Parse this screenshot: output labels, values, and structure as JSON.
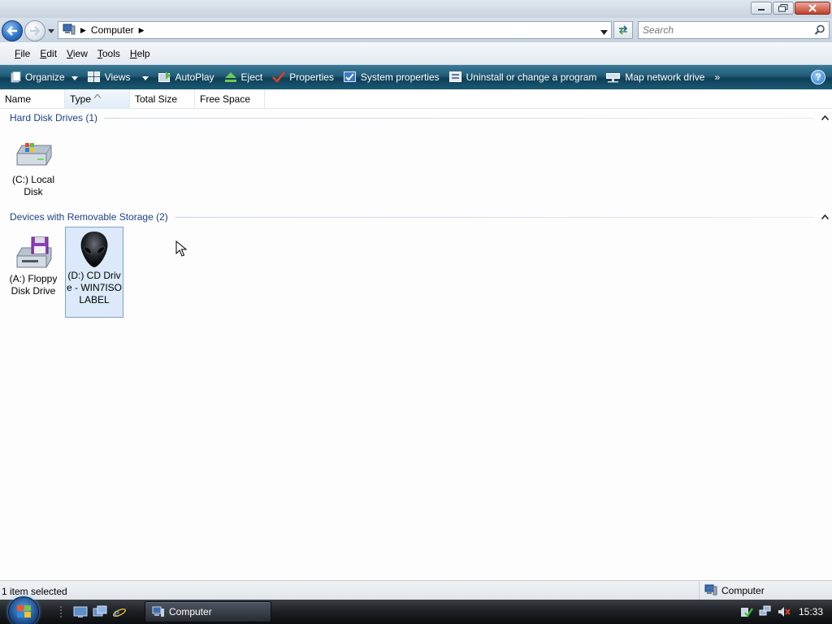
{
  "window": {
    "title": ""
  },
  "address": {
    "crumbs": [
      "Computer"
    ],
    "icon": "computer-icon"
  },
  "search": {
    "placeholder": "Search"
  },
  "menu": {
    "items": [
      {
        "label": "File",
        "key": "F"
      },
      {
        "label": "Edit",
        "key": "E"
      },
      {
        "label": "View",
        "key": "V"
      },
      {
        "label": "Tools",
        "key": "T"
      },
      {
        "label": "Help",
        "key": "H"
      }
    ]
  },
  "commands": {
    "organize": "Organize",
    "views": "Views",
    "autoplay": "AutoPlay",
    "eject": "Eject",
    "properties": "Properties",
    "system_properties": "System properties",
    "uninstall": "Uninstall or change a program",
    "map_drive": "Map network drive",
    "more": "»"
  },
  "columns": [
    "Name",
    "Type",
    "Total Size",
    "Free Space"
  ],
  "groups": [
    {
      "title": "Hard Disk Drives (1)",
      "items": [
        {
          "label": "(C:) Local Disk",
          "icon": "hard-drive-icon"
        }
      ]
    },
    {
      "title": "Devices with Removable Storage (2)",
      "items": [
        {
          "label": "(A:) Floppy Disk Drive",
          "icon": "floppy-drive-icon"
        },
        {
          "label": "(D:) CD Drive - WIN7ISOLABEL",
          "icon": "alien-cd-icon"
        }
      ]
    }
  ],
  "status": {
    "selection": "1 item selected",
    "location": "Computer"
  },
  "taskbar": {
    "active_window": "Computer",
    "clock": "15:33"
  },
  "colors": {
    "command_bar": "#215c78",
    "selection": "#dbe9f8",
    "group_title": "#1e3f8a"
  }
}
